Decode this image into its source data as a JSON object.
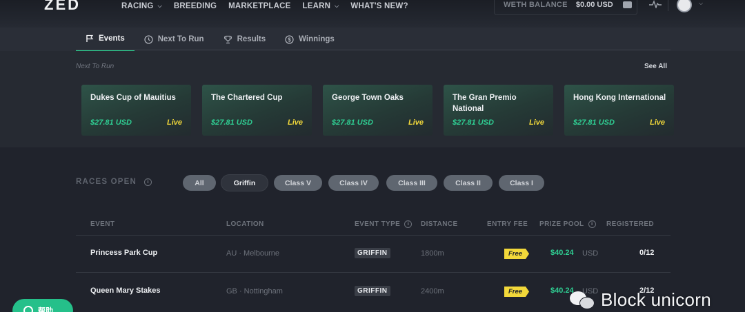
{
  "app": {
    "logo": "ZED"
  },
  "nav": {
    "items": [
      {
        "label": "RACING",
        "dropdown": true
      },
      {
        "label": "BREEDING",
        "dropdown": false
      },
      {
        "label": "MARKETPLACE",
        "dropdown": false
      },
      {
        "label": "LEARN",
        "dropdown": true
      },
      {
        "label": "WHAT'S NEW?",
        "dropdown": false
      }
    ]
  },
  "balance": {
    "label": "WETH BALANCE",
    "value": "$0.00 USD"
  },
  "tabs": [
    {
      "label": "Events",
      "icon": "flag-icon",
      "active": true
    },
    {
      "label": "Next To Run",
      "icon": "clock-icon",
      "active": false
    },
    {
      "label": "Results",
      "icon": "trophy-icon",
      "active": false
    },
    {
      "label": "Winnings",
      "icon": "dollar-coin-icon",
      "active": false
    }
  ],
  "next_to_run": {
    "title": "Next To Run",
    "see_all": "See All",
    "cards": [
      {
        "name": "Dukes Cup of Mauitius",
        "price": "$27.81 USD",
        "status": "Live"
      },
      {
        "name": "The Chartered Cup",
        "price": "$27.81 USD",
        "status": "Live"
      },
      {
        "name": "George Town Oaks",
        "price": "$27.81 USD",
        "status": "Live"
      },
      {
        "name": "The Gran Premio National",
        "price": "$27.81 USD",
        "status": "Live"
      },
      {
        "name": "Hong Kong International",
        "price": "$27.81 USD",
        "status": "Live"
      }
    ]
  },
  "races_open": {
    "title": "RACES OPEN",
    "filters": [
      {
        "label": "All",
        "active": false
      },
      {
        "label": "Griffin",
        "active": true
      },
      {
        "label": "Class V",
        "active": false
      },
      {
        "label": "Class IV",
        "active": false
      },
      {
        "label": "Class III",
        "active": false
      },
      {
        "label": "Class II",
        "active": false
      },
      {
        "label": "Class I",
        "active": false
      }
    ]
  },
  "table": {
    "headers": {
      "event": "EVENT",
      "location": "LOCATION",
      "event_type": "EVENT TYPE",
      "distance": "DISTANCE",
      "entry_fee": "ENTRY FEE",
      "prize_pool": "PRIZE POOL",
      "registered": "REGISTERED"
    },
    "rows": [
      {
        "event": "Princess Park Cup",
        "location": "AU · Melbourne",
        "type": "GRIFFIN",
        "distance": "1800m",
        "fee": "Free",
        "prize": "$40.24",
        "currency": "USD",
        "registered": "0/12"
      },
      {
        "event": "Queen Mary Stakes",
        "location": "GB · Nottingham",
        "type": "GRIFFIN",
        "distance": "2400m",
        "fee": "Free",
        "prize": "$40.24",
        "currency": "USD",
        "registered": "2/12"
      }
    ]
  },
  "help": {
    "label": "帮助"
  },
  "watermark": {
    "text": "Block unicorn"
  },
  "colors": {
    "accent_green": "#2fcd92",
    "live_yellow": "#f2d83a",
    "background": "#20232c"
  }
}
